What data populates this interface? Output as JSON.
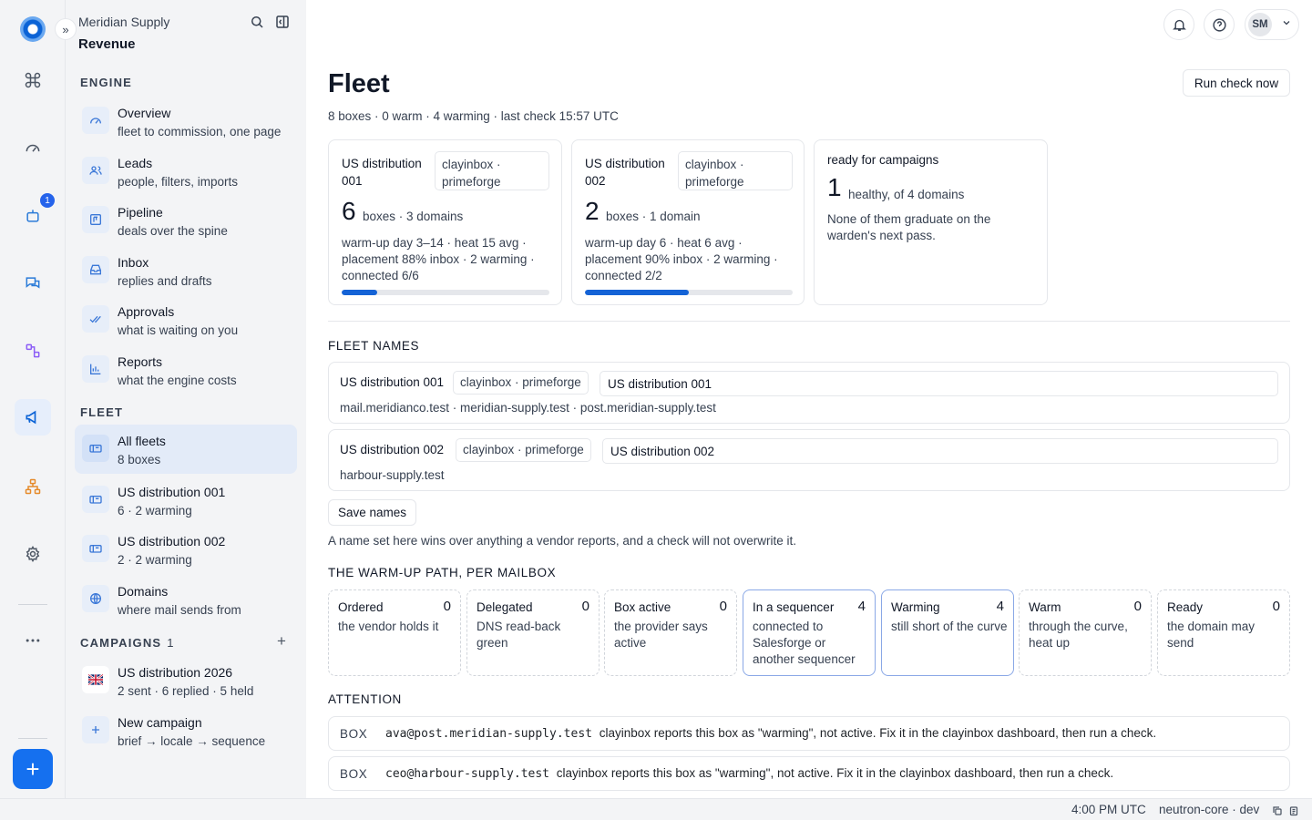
{
  "app": {
    "org": "Meridian Supply",
    "workspace": "Revenue"
  },
  "rail": {
    "bot_badge": "1"
  },
  "sidebar": {
    "engine_heading": "ENGINE",
    "engine": [
      {
        "title": "Overview",
        "sub": "fleet to commission, one page",
        "icon": "gauge-icon"
      },
      {
        "title": "Leads",
        "sub": "people, filters, imports",
        "icon": "users-icon"
      },
      {
        "title": "Pipeline",
        "sub": "deals over the spine",
        "icon": "pipeline-icon"
      },
      {
        "title": "Inbox",
        "sub": "replies and drafts",
        "icon": "inbox-icon"
      },
      {
        "title": "Approvals",
        "sub": "what is waiting on you",
        "icon": "check-icon"
      },
      {
        "title": "Reports",
        "sub": "what the engine costs",
        "icon": "chart-icon"
      }
    ],
    "fleet_heading": "FLEET",
    "fleet": [
      {
        "title": "All fleets",
        "sub": "8 boxes",
        "icon": "mailbox-icon"
      },
      {
        "title": "US distribution 001",
        "sub": "6 · 2 warming",
        "icon": "mailbox-icon"
      },
      {
        "title": "US distribution 002",
        "sub": "2 · 2 warming",
        "icon": "mailbox-icon"
      },
      {
        "title": "Domains",
        "sub": "where mail sends from",
        "icon": "globe-icon"
      }
    ],
    "campaigns_heading": "CAMPAIGNS",
    "campaigns_count": "1",
    "campaigns": [
      {
        "title": "US distribution 2026",
        "sub": "2 sent · 6 replied · 5 held",
        "icon": "uk-flag-icon"
      },
      {
        "title": "New campaign",
        "sub": "brief → locale → sequence",
        "icon": "plus-icon"
      }
    ]
  },
  "header": {
    "avatar_initials": "SM"
  },
  "page": {
    "title": "Fleet",
    "subtitle": "8 boxes · 0 warm · 4 warming · last check 15:57 UTC",
    "run_check_label": "Run check now"
  },
  "cards": [
    {
      "name": "US distribution 001",
      "vendor": "clayinbox · primeforge",
      "count": "6",
      "count_label": "boxes · 3 domains",
      "detail": "warm-up day 3–14 · heat 15 avg · placement 88% inbox · 2 warming · connected 6/6",
      "progress": 0.17
    },
    {
      "name": "US distribution 002",
      "vendor": "clayinbox · primeforge",
      "count": "2",
      "count_label": "boxes · 1 domain",
      "detail": "warm-up day 6 · heat 6 avg · placement 90% inbox · 2 warming · connected 2/2",
      "progress": 0.5
    }
  ],
  "ready": {
    "title": "ready for campaigns",
    "count": "1",
    "count_label": "healthy, of 4 domains",
    "detail": "None of them graduate on the warden's next pass."
  },
  "fleet_names": {
    "heading": "FLEET NAMES",
    "rows": [
      {
        "name": "US distribution 001",
        "vendor": "clayinbox · primeforge",
        "value": "US distribution 001",
        "domains": "mail.meridianco.test · meridian-supply.test · post.meridian-supply.test"
      },
      {
        "name": "US distribution 002",
        "vendor": "clayinbox · primeforge",
        "value": "US distribution 002",
        "domains": "harbour-supply.test"
      }
    ],
    "save_label": "Save names",
    "note": "A name set here wins over anything a vendor reports, and a check will not overwrite it."
  },
  "warmup": {
    "heading": "THE WARM-UP PATH, PER MAILBOX",
    "stages": [
      {
        "title": "Ordered",
        "count": "0",
        "desc": "the vendor holds it"
      },
      {
        "title": "Delegated",
        "count": "0",
        "desc": "DNS read-back green"
      },
      {
        "title": "Box active",
        "count": "0",
        "desc": "the provider says active"
      },
      {
        "title": "In a sequencer",
        "count": "4",
        "desc": "connected to Salesforge or another sequencer"
      },
      {
        "title": "Warming",
        "count": "4",
        "desc": "still short of the curve"
      },
      {
        "title": "Warm",
        "count": "0",
        "desc": "through the curve, heat up"
      },
      {
        "title": "Ready",
        "count": "0",
        "desc": "the domain may send"
      }
    ]
  },
  "attention": {
    "heading": "ATTENTION",
    "items": [
      {
        "tag": "BOX",
        "email": "ava@post.meridian-supply.test",
        "message": "clayinbox reports this box as \"warming\", not active. Fix it in the clayinbox dashboard, then run a check."
      },
      {
        "tag": "BOX",
        "email": "ceo@harbour-supply.test",
        "message": "clayinbox reports this box as \"warming\", not active. Fix it in the clayinbox dashboard, then run a check."
      }
    ]
  },
  "status": {
    "time": "4:00 PM UTC",
    "env": "neutron-core · dev"
  },
  "colors": {
    "accent": "#1570ef",
    "progress": "#1463d6",
    "rail_bg": "#f3f4f6",
    "active_item": "#e3ebf8"
  }
}
